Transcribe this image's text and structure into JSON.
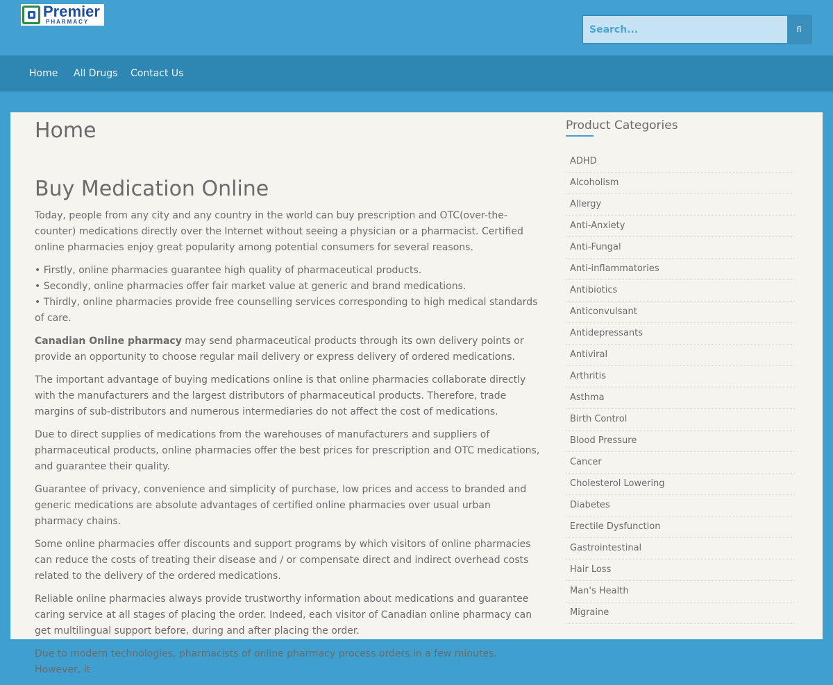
{
  "header": {
    "logo": {
      "title": "Premier",
      "subtitle": "PHARMACY"
    },
    "search": {
      "placeholder": "Search...",
      "button_icon": "search-icon",
      "button_glyph": "fl"
    }
  },
  "nav": {
    "items": [
      {
        "label": "Home"
      },
      {
        "label": "All Drugs"
      },
      {
        "label": "Contact Us"
      }
    ]
  },
  "main": {
    "page_title": "Home",
    "article": {
      "heading": "Buy Medication Online",
      "intro": "Today, people from any city and any country in the world can buy prescription and OTC(over-the-counter) medications directly over the Internet without seeing a physician or a pharmacist. Certified online pharmacies enjoy great popularity among potential consumers for several reasons.",
      "bullets": [
        "• Firstly, online pharmacies guarantee high quality of pharmaceutical products.",
        "• Secondly, online pharmacies offer fair market value at generic and brand medications.",
        "• Thirdly, online pharmacies provide free counselling services corresponding to high medical standards of care."
      ],
      "delivery_bold": "Canadian Online pharmacy",
      "delivery_rest": " may send pharmaceutical products through its own delivery points or provide an opportunity to choose regular mail delivery or express delivery of ordered medications.",
      "paragraphs": [
        "The important advantage of buying medications online is that online pharmacies collaborate directly with the manufacturers and the largest distributors of pharmaceutical products. Therefore, trade margins of sub-distributors and numerous intermediaries do not affect the cost of medications.",
        "Due to direct supplies of medications from the warehouses of manufacturers and suppliers of pharmaceutical products, online pharmacies offer the best prices for prescription and OTC medications, and guarantee their quality.",
        "Guarantee of privacy, convenience and simplicity of purchase, low prices and access to branded and generic medications are absolute advantages of certified online pharmacies over usual urban pharmacy chains.",
        "Some online pharmacies offer discounts and support programs by which visitors of online pharmacies can reduce the costs of treating their disease and / or compensate direct and indirect overhead costs related to the delivery of the ordered medications.",
        "Reliable online pharmacies always provide trustworthy information about medications and guarantee caring service at all stages of placing the order. Indeed, each visitor of Canadian online pharmacy can get multilingual support before, during and after placing the order.",
        "Due to modern technologies, pharmacists of online pharmacy process orders in a few minutes. However, it"
      ]
    }
  },
  "sidebar": {
    "title": "Product Categories",
    "categories": [
      "ADHD",
      "Alcoholism",
      "Allergy",
      "Anti-Anxiety",
      "Anti-Fungal",
      "Anti-inflammatories",
      "Antibiotics",
      "Anticonvulsant",
      "Antidepressants",
      "Antiviral",
      "Arthritis",
      "Asthma",
      "Birth Control",
      "Blood Pressure",
      "Cancer",
      "Cholesterol Lowering",
      "Diabetes",
      "Erectile Dysfunction",
      "Gastrointestinal",
      "Hair Loss",
      "Man's Health",
      "Migraine"
    ]
  },
  "colors": {
    "header_bg": "#42a1d1",
    "nav_bg": "#2e86b3",
    "page_bg": "#3f9fcf",
    "card_bg": "#f5f4ef",
    "text": "#6b6b6b",
    "accent": "#42a1d1"
  }
}
